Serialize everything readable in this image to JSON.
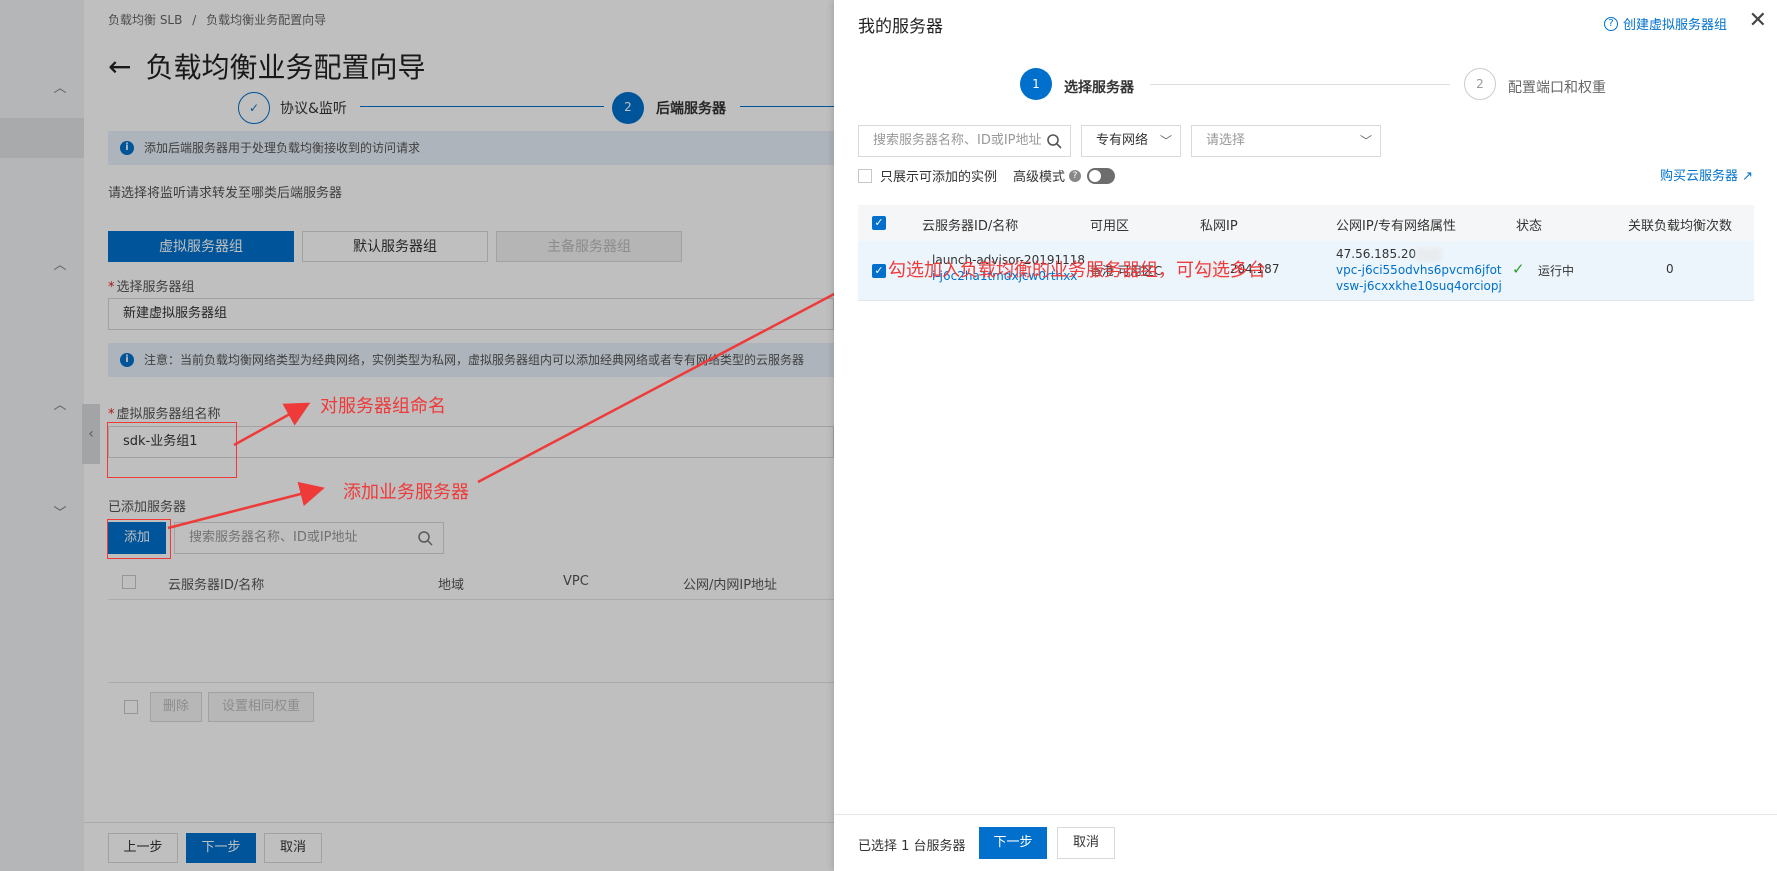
{
  "breadcrumb": [
    "负载均衡 SLB",
    "/",
    "负载均衡业务配置向导"
  ],
  "page_title": "负载均衡业务配置向导",
  "wizard_steps": [
    {
      "label": "协议&监听",
      "state": "done"
    },
    {
      "label": "后端服务器",
      "num": "2",
      "state": "active"
    }
  ],
  "info1": "添加后端服务器用于处理负载均衡接收到的访问请求",
  "forward_label": "请选择将监听请求转发至哪类后端服务器",
  "server_types": [
    "虚拟服务器组",
    "默认服务器组",
    "主备服务器组"
  ],
  "select_group_label": "选择服务器组",
  "select_group_value": "新建虚拟服务器组",
  "info2": "注意：当前负载均衡网络类型为经典网络，实例类型为私网，虚拟服务器组内可以添加经典网络或者专有网络类型的云服务器",
  "group_name_label": "虚拟服务器组名称",
  "group_name_value": "sdk-业务组1",
  "added_label": "已添加服务器",
  "add_button": "添加",
  "bg_search_placeholder": "搜索服务器名称、ID或IP地址",
  "bg_table_headers": [
    "云服务器ID/名称",
    "地域",
    "VPC",
    "公网/内网IP地址"
  ],
  "bg_delete": "删除",
  "bg_set_weight": "设置相同权重",
  "prev_step": "上一步",
  "next_step": "下一步",
  "cancel": "取消",
  "annotations": {
    "name_group": "对服务器组命名",
    "add_server": "添加业务服务器",
    "select_servers": "勾选加入负载均衡的业务服务器组，可勾选多台"
  },
  "drawer": {
    "title": "我的服务器",
    "create_link": "创建虚拟服务器组",
    "steps": [
      {
        "num": "1",
        "label": "选择服务器",
        "state": "active"
      },
      {
        "num": "2",
        "label": "配置端口和权重",
        "state": "pending"
      }
    ],
    "search_placeholder": "搜索服务器名称、ID或IP地址",
    "network_select": "专有网络",
    "vpc_select_placeholder": "请选择",
    "only_addable": "只展示可添加的实例",
    "advanced_mode": "高级模式",
    "buy_link": "购买云服务器",
    "table_headers": [
      "云服务器ID/名称",
      "可用区",
      "私网IP",
      "公网IP/专有网络属性",
      "状态",
      "关联负载均衡次数"
    ],
    "rows": [
      {
        "name": "launch-advisor-20191118",
        "id": "i-j6c2ha1tmdxjcw0rthxx",
        "zone": "香港 可用区C",
        "private_ip": "204.187",
        "public_ip": "47.56.185.20",
        "vpc": "vpc-j6ci55odvhs6pvcm6jfot",
        "vswitch": "vsw-j6cxxkhe10suq4orciopj",
        "status": "运行中",
        "lb_count": "0",
        "checked": true
      }
    ],
    "selected_count_text": "已选择 1 台服务器",
    "next": "下一步",
    "cancel": "取消"
  },
  "colors": {
    "primary": "#0070cc",
    "annotation": "#ef3a3a"
  }
}
